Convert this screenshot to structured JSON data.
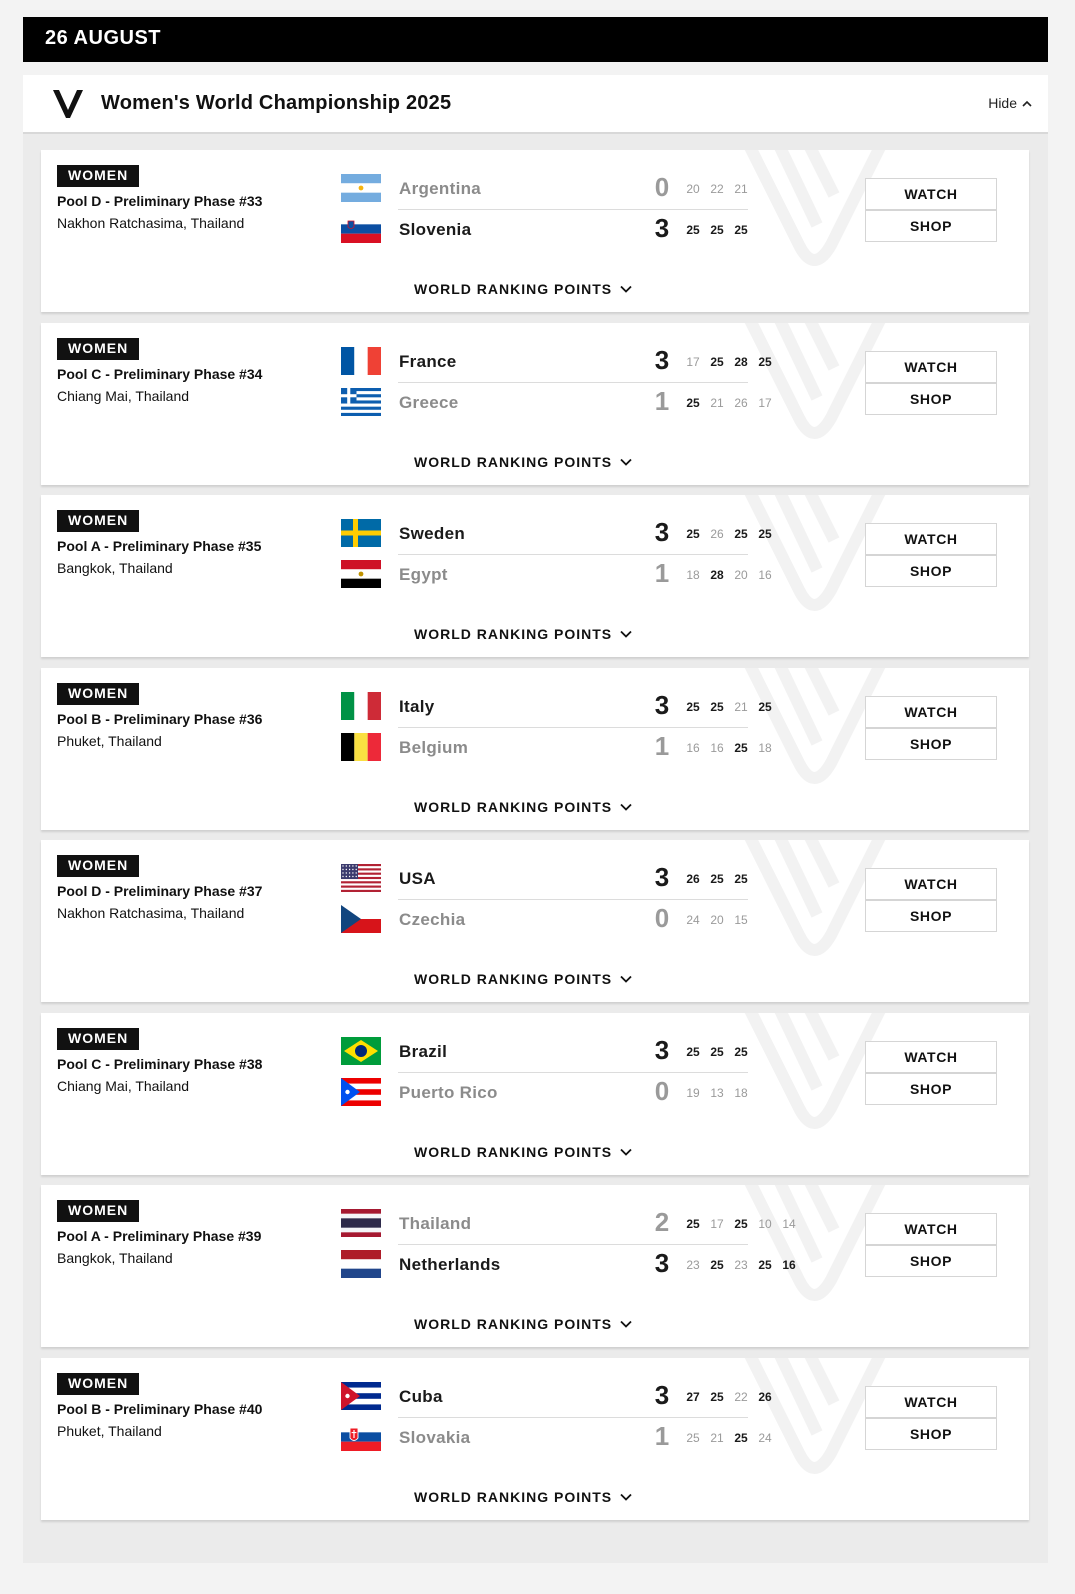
{
  "date": "26 AUGUST",
  "competition": {
    "title": "Women's World Championship 2025",
    "hide_label": "Hide"
  },
  "wrp_label": "WORLD RANKING POINTS",
  "watch_label": "WATCH",
  "shop_label": "SHOP",
  "matches": [
    {
      "category": "WOMEN",
      "pool": "Pool D - Preliminary Phase #33",
      "venue": "Nakhon Ratchasima, Thailand",
      "teams": [
        {
          "name": "Argentina",
          "flag": "argentina",
          "score": "0",
          "won": false,
          "sets": [
            "20",
            "22",
            "21"
          ],
          "set_won": [
            false,
            false,
            false
          ]
        },
        {
          "name": "Slovenia",
          "flag": "slovenia",
          "score": "3",
          "won": true,
          "sets": [
            "25",
            "25",
            "25"
          ],
          "set_won": [
            true,
            true,
            true
          ]
        }
      ]
    },
    {
      "category": "WOMEN",
      "pool": "Pool C - Preliminary Phase #34",
      "venue": "Chiang Mai, Thailand",
      "teams": [
        {
          "name": "France",
          "flag": "france",
          "score": "3",
          "won": true,
          "sets": [
            "17",
            "25",
            "28",
            "25"
          ],
          "set_won": [
            false,
            true,
            true,
            true
          ]
        },
        {
          "name": "Greece",
          "flag": "greece",
          "score": "1",
          "won": false,
          "sets": [
            "25",
            "21",
            "26",
            "17"
          ],
          "set_won": [
            true,
            false,
            false,
            false
          ]
        }
      ]
    },
    {
      "category": "WOMEN",
      "pool": "Pool A - Preliminary Phase #35",
      "venue": "Bangkok, Thailand",
      "teams": [
        {
          "name": "Sweden",
          "flag": "sweden",
          "score": "3",
          "won": true,
          "sets": [
            "25",
            "26",
            "25",
            "25"
          ],
          "set_won": [
            true,
            false,
            true,
            true
          ]
        },
        {
          "name": "Egypt",
          "flag": "egypt",
          "score": "1",
          "won": false,
          "sets": [
            "18",
            "28",
            "20",
            "16"
          ],
          "set_won": [
            false,
            true,
            false,
            false
          ]
        }
      ]
    },
    {
      "category": "WOMEN",
      "pool": "Pool B - Preliminary Phase #36",
      "venue": "Phuket, Thailand",
      "teams": [
        {
          "name": "Italy",
          "flag": "italy",
          "score": "3",
          "won": true,
          "sets": [
            "25",
            "25",
            "21",
            "25"
          ],
          "set_won": [
            true,
            true,
            false,
            true
          ]
        },
        {
          "name": "Belgium",
          "flag": "belgium",
          "score": "1",
          "won": false,
          "sets": [
            "16",
            "16",
            "25",
            "18"
          ],
          "set_won": [
            false,
            false,
            true,
            false
          ]
        }
      ]
    },
    {
      "category": "WOMEN",
      "pool": "Pool D - Preliminary Phase #37",
      "venue": "Nakhon Ratchasima, Thailand",
      "teams": [
        {
          "name": "USA",
          "flag": "usa",
          "score": "3",
          "won": true,
          "sets": [
            "26",
            "25",
            "25"
          ],
          "set_won": [
            true,
            true,
            true
          ]
        },
        {
          "name": "Czechia",
          "flag": "czechia",
          "score": "0",
          "won": false,
          "sets": [
            "24",
            "20",
            "15"
          ],
          "set_won": [
            false,
            false,
            false
          ]
        }
      ]
    },
    {
      "category": "WOMEN",
      "pool": "Pool C - Preliminary Phase #38",
      "venue": "Chiang Mai, Thailand",
      "teams": [
        {
          "name": "Brazil",
          "flag": "brazil",
          "score": "3",
          "won": true,
          "sets": [
            "25",
            "25",
            "25"
          ],
          "set_won": [
            true,
            true,
            true
          ]
        },
        {
          "name": "Puerto Rico",
          "flag": "puerto-rico",
          "score": "0",
          "won": false,
          "sets": [
            "19",
            "13",
            "18"
          ],
          "set_won": [
            false,
            false,
            false
          ]
        }
      ]
    },
    {
      "category": "WOMEN",
      "pool": "Pool A - Preliminary Phase #39",
      "venue": "Bangkok, Thailand",
      "teams": [
        {
          "name": "Thailand",
          "flag": "thailand",
          "score": "2",
          "won": false,
          "sets": [
            "25",
            "17",
            "25",
            "10",
            "14"
          ],
          "set_won": [
            true,
            false,
            true,
            false,
            false
          ]
        },
        {
          "name": "Netherlands",
          "flag": "netherlands",
          "score": "3",
          "won": true,
          "sets": [
            "23",
            "25",
            "23",
            "25",
            "16"
          ],
          "set_won": [
            false,
            true,
            false,
            true,
            true
          ]
        }
      ]
    },
    {
      "category": "WOMEN",
      "pool": "Pool B - Preliminary Phase #40",
      "venue": "Phuket, Thailand",
      "teams": [
        {
          "name": "Cuba",
          "flag": "cuba",
          "score": "3",
          "won": true,
          "sets": [
            "27",
            "25",
            "22",
            "26"
          ],
          "set_won": [
            true,
            true,
            false,
            true
          ]
        },
        {
          "name": "Slovakia",
          "flag": "slovakia",
          "score": "1",
          "won": false,
          "sets": [
            "25",
            "21",
            "25",
            "24"
          ],
          "set_won": [
            false,
            false,
            true,
            false
          ]
        }
      ]
    }
  ]
}
